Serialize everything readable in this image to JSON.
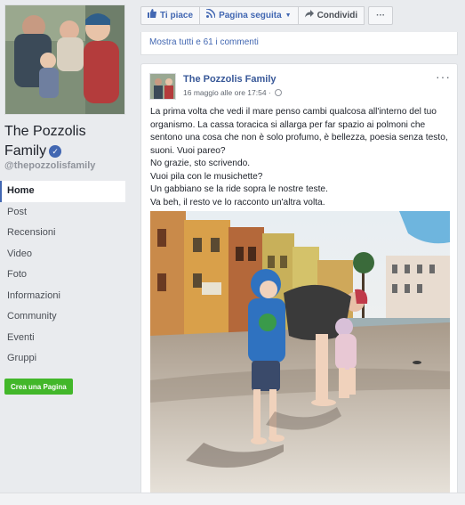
{
  "sidebar": {
    "page_name": "The Pozzolis Family",
    "handle": "@thepozzolisfamily",
    "nav": [
      "Home",
      "Post",
      "Recensioni",
      "Video",
      "Foto",
      "Informazioni",
      "Community",
      "Eventi",
      "Gruppi"
    ],
    "active_nav": "Home",
    "create_page_label": "Crea una Pagina"
  },
  "toolbar": {
    "like_label": "Ti piace",
    "follow_label": "Pagina seguita",
    "share_label": "Condividi",
    "more_label": "···"
  },
  "comments": {
    "show_all_label": "Mostra tutti e 61 i commenti"
  },
  "post": {
    "author": "The Pozzolis Family",
    "date": "16 maggio alle ore 17:54 · ",
    "menu_label": "···",
    "paragraphs": [
      "La prima volta che vedi il mare penso cambi qualcosa all'interno del tuo organismo. La cassa toracica si allarga per far spazio ai polmoni che sentono una cosa che non è solo profumo, è bellezza, poesia senza testo, suoni. Vuoi pareo?",
      "No grazie, sto scrivendo.",
      "Vuoi pila con le musichette?",
      "Un gabbiano se la ride sopra le nostre teste.",
      "Va beh, il resto ve lo racconto un'altra volta."
    ]
  },
  "colors": {
    "facebook_blue": "#4267b2",
    "link_blue": "#385898",
    "create_green": "#42b72a",
    "background": "#e9ebee"
  },
  "icons": {
    "like": "thumbs-up-icon",
    "follow": "rss-icon",
    "share": "share-arrow-icon",
    "verified": "verified-check-icon",
    "privacy": "globe-icon"
  }
}
